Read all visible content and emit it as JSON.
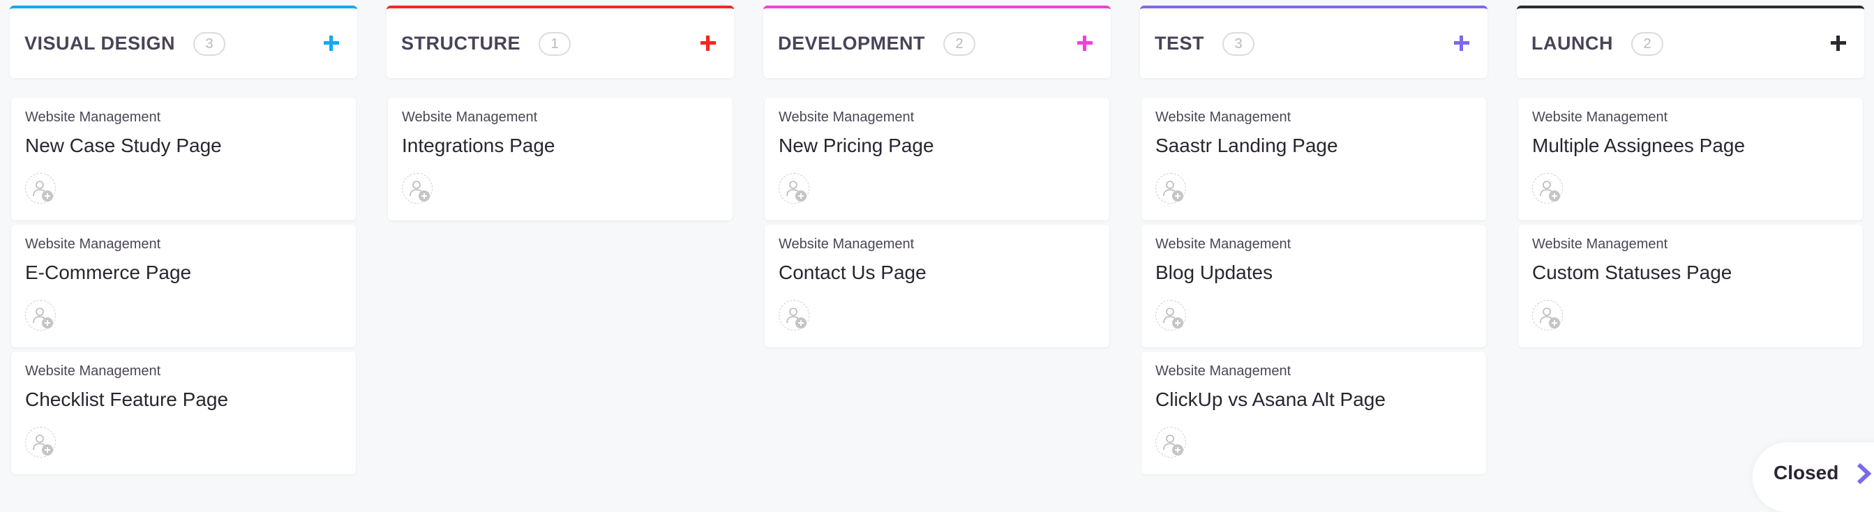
{
  "board": {
    "columns": [
      {
        "title": "VISUAL DESIGN",
        "count": "3",
        "accent": "#11a8f5",
        "cards": [
          {
            "list": "Website Management",
            "title": "New Case Study Page"
          },
          {
            "list": "Website Management",
            "title": "E-Commerce Page"
          },
          {
            "list": "Website Management",
            "title": "Checklist Feature Page"
          }
        ]
      },
      {
        "title": "STRUCTURE",
        "count": "1",
        "accent": "#f4281e",
        "cards": [
          {
            "list": "Website Management",
            "title": "Integrations Page"
          }
        ]
      },
      {
        "title": "DEVELOPMENT",
        "count": "2",
        "accent": "#f53fd8",
        "cards": [
          {
            "list": "Website Management",
            "title": "New Pricing Page"
          },
          {
            "list": "Website Management",
            "title": "Contact Us Page"
          }
        ]
      },
      {
        "title": "TEST",
        "count": "3",
        "accent": "#7b68ee",
        "cards": [
          {
            "list": "Website Management",
            "title": "Saastr Landing Page"
          },
          {
            "list": "Website Management",
            "title": "Blog Updates"
          },
          {
            "list": "Website Management",
            "title": "ClickUp vs Asana Alt Page"
          }
        ]
      },
      {
        "title": "LAUNCH",
        "count": "2",
        "accent": "#2a2830",
        "cards": [
          {
            "list": "Website Management",
            "title": "Multiple Assignees Page"
          },
          {
            "list": "Website Management",
            "title": "Custom Statuses Page"
          }
        ]
      }
    ]
  },
  "closed": {
    "label": "Closed",
    "chevron_color": "#7b68ee"
  },
  "icons": {
    "add_task": "plus-icon",
    "assignee": "add-assignee-icon",
    "expand_closed": "chevron-right-icon"
  }
}
